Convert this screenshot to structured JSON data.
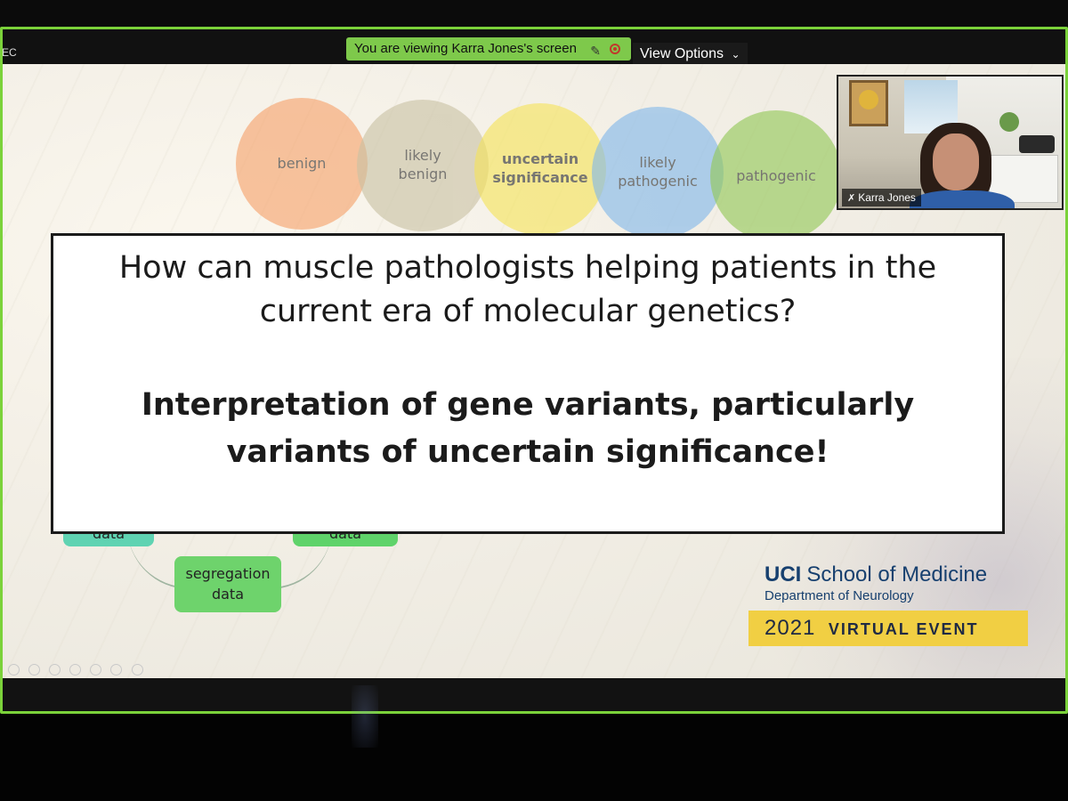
{
  "zoom": {
    "left_label": "EC",
    "banner_text": "You are viewing Karra Jones's screen",
    "view_options_label": "View Options",
    "view_options_chevron": "chevron-down-icon",
    "accent_color": "#7bd23a"
  },
  "slide": {
    "circles": [
      {
        "label": "benign",
        "color": "#f6a26b"
      },
      {
        "label": "likely\nbenign",
        "color": "#c9c2a4"
      },
      {
        "label": "uncertain\nsignificance",
        "color": "#f5e45a"
      },
      {
        "label": "likely\npathogenic",
        "color": "#82b8ea"
      },
      {
        "label": "pathogenic",
        "color": "#93c857"
      }
    ],
    "question": "How can muscle pathologists helping patients in the current era of molecular genetics?",
    "answer": "Interpretation of gene variants, particularly variants of uncertain significance!",
    "nodes": {
      "node_a": "data",
      "node_b": "data",
      "segregation": "segregation\ndata"
    },
    "branding": {
      "school_bold": "UCI",
      "school_rest": "School of Medicine",
      "department": "Department of Neurology",
      "event_year": "2021",
      "event_label": "VIRTUAL EVENT"
    }
  },
  "video": {
    "participant_name": "Karra Jones"
  }
}
